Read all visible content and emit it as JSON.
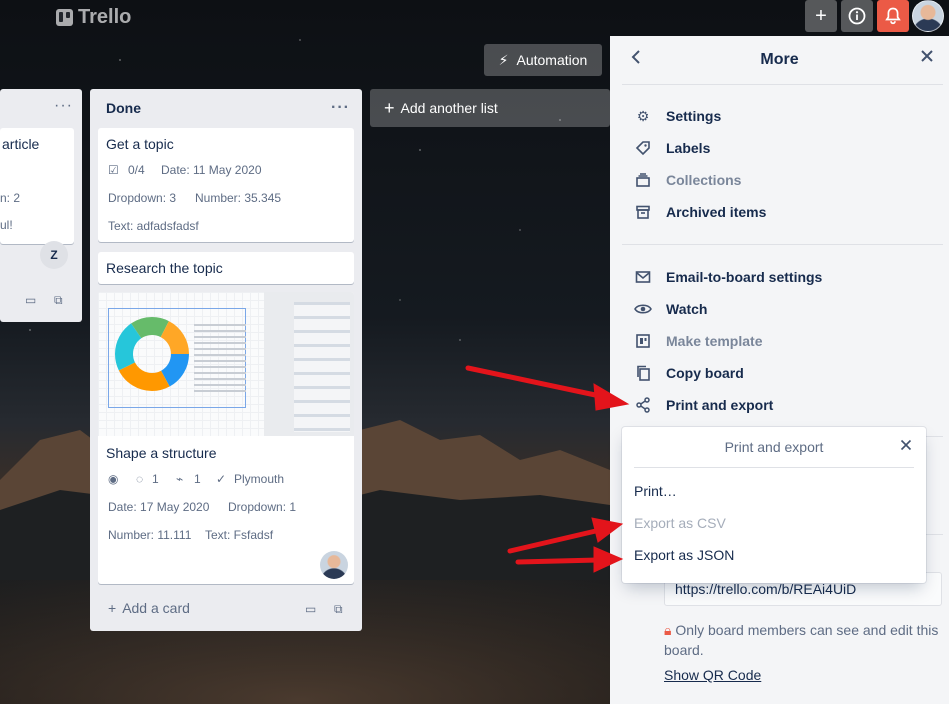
{
  "app": {
    "logo_text": "Trello"
  },
  "topbar": {
    "add_icon": "plus-icon",
    "info_icon": "info-icon",
    "bell_icon": "bell-icon",
    "bell_color": "#eb5a46"
  },
  "board": {
    "automation_label": "Automation",
    "add_list_label": "Add another list",
    "left_list": {
      "card": {
        "title_fragment": "article",
        "line2": "n: 2",
        "line3": "ul!",
        "member_initial": "Z"
      }
    },
    "done_list": {
      "title": "Done",
      "add_card_label": "Add a card",
      "cards": [
        {
          "title": "Get a topic",
          "checklist": "0/4",
          "date": "Date: 11 May 2020",
          "dropdown": "Dropdown: 3",
          "number": "Number: 35.345",
          "text": "Text: adfadsfadsf"
        },
        {
          "title": "Research the topic"
        },
        {
          "title": "Shape a structure",
          "comments": "1",
          "attachments": "1",
          "location": "Plymouth",
          "date": "Date: 17 May 2020",
          "dropdown": "Dropdown: 1",
          "number": "Number: 11.111",
          "text": "Text: Fsfadsf"
        }
      ]
    }
  },
  "menu": {
    "title": "More",
    "items_top": [
      {
        "label": "Settings",
        "icon": "gear-icon",
        "muted": false
      },
      {
        "label": "Labels",
        "icon": "tag-icon",
        "muted": false
      },
      {
        "label": "Collections",
        "icon": "collections-icon",
        "muted": true
      },
      {
        "label": "Archived items",
        "icon": "archive-icon",
        "muted": false
      }
    ],
    "items_bottom": [
      {
        "label": "Email-to-board settings",
        "icon": "email-icon",
        "muted": false
      },
      {
        "label": "Watch",
        "icon": "eye-icon",
        "muted": false
      },
      {
        "label": "Make template",
        "icon": "template-icon",
        "muted": true
      },
      {
        "label": "Copy board",
        "icon": "copy-icon",
        "muted": false
      },
      {
        "label": "Print and export",
        "icon": "share-icon",
        "muted": false
      }
    ],
    "board_link": "https://trello.com/b/REAi4UiD",
    "notice": "Only board members can see and edit this board.",
    "qr_label": "Show QR Code"
  },
  "popover": {
    "title": "Print and export",
    "items": [
      {
        "label": "Print…",
        "muted": false
      },
      {
        "label": "Export as CSV",
        "muted": true
      },
      {
        "label": "Export as JSON",
        "muted": false
      }
    ]
  },
  "annotation_color": "#e3141b"
}
